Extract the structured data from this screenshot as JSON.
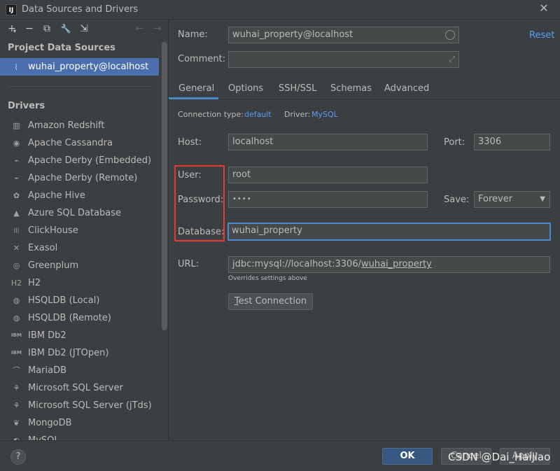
{
  "window": {
    "title": "Data Sources and Drivers",
    "app_icon": "IJ"
  },
  "toolbar": {
    "add": "+",
    "add_arrow": "▾",
    "remove": "−",
    "copy": "⧉",
    "wrench": "🔧",
    "import": "⇲",
    "back": "←",
    "forward": "→"
  },
  "left": {
    "project_title": "Project Data Sources",
    "data_source": "wuhai_property@localhost",
    "drivers_title": "Drivers",
    "drivers": [
      {
        "label": "Amazon Redshift",
        "icon": "▥"
      },
      {
        "label": "Apache Cassandra",
        "icon": "◉"
      },
      {
        "label": "Apache Derby (Embedded)",
        "icon": "⌁"
      },
      {
        "label": "Apache Derby (Remote)",
        "icon": "⌁"
      },
      {
        "label": "Apache Hive",
        "icon": "✿"
      },
      {
        "label": "Azure SQL Database",
        "icon": "▲"
      },
      {
        "label": "ClickHouse",
        "icon": "|||"
      },
      {
        "label": "Exasol",
        "icon": "✕"
      },
      {
        "label": "Greenplum",
        "icon": "◎"
      },
      {
        "label": "H2",
        "icon": "H2"
      },
      {
        "label": "HSQLDB (Local)",
        "icon": "◍"
      },
      {
        "label": "HSQLDB (Remote)",
        "icon": "◍"
      },
      {
        "label": "IBM Db2",
        "icon": "IBM"
      },
      {
        "label": "IBM Db2 (JTOpen)",
        "icon": "IBM"
      },
      {
        "label": "MariaDB",
        "icon": "⌒"
      },
      {
        "label": "Microsoft SQL Server",
        "icon": "⚘"
      },
      {
        "label": "Microsoft SQL Server (jTds)",
        "icon": "⚘"
      },
      {
        "label": "MongoDB",
        "icon": "❦"
      },
      {
        "label": "MySQL",
        "icon": "◐"
      }
    ]
  },
  "form": {
    "name_label": "Name:",
    "name_value": "wuhai_property@localhost",
    "reset": "Reset",
    "comment_label": "Comment:",
    "comment_value": "",
    "expand_icon": "⤢",
    "tabs": [
      "General",
      "Options",
      "SSH/SSL",
      "Schemas",
      "Advanced"
    ],
    "conn_type_label": "Connection type:",
    "conn_type_value": "default",
    "driver_label": "Driver:",
    "driver_value": "MySQL",
    "host_label": "Host:",
    "host_value": "localhost",
    "port_label": "Port:",
    "port_value": "3306",
    "user_label": "User:",
    "user_value": "root",
    "password_label": "Password:",
    "password_value": "••••",
    "save_label": "Save:",
    "save_value": "Forever",
    "database_label": "Database:",
    "database_value": "wuhai_property",
    "url_label": "URL:",
    "url_prefix": "jdbc:mysql://localhost:3306/",
    "url_db": "wuhai_property",
    "url_note": "Overrides settings above",
    "test_prefix": "T",
    "test_rest": "est Connection"
  },
  "footer": {
    "help": "?",
    "ok": "OK",
    "cancel": "Cancel",
    "apply": "Apply",
    "watermark": "CSDN @Dai_Haijiao"
  }
}
